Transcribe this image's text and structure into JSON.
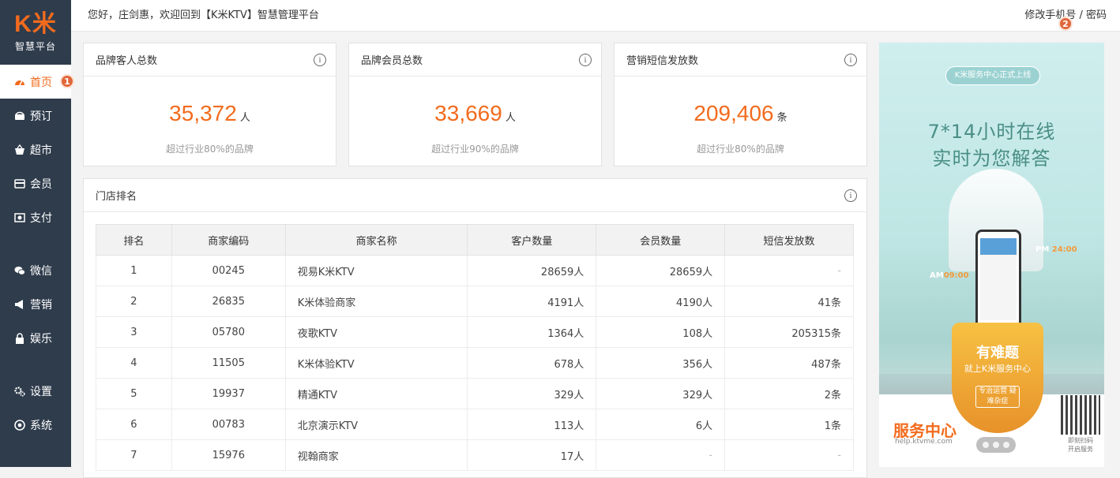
{
  "app": {
    "logo_text": "K米",
    "logo_subtitle": "智慧平台",
    "accent_color": "#f26b1d",
    "sidebar_color": "#2f3c4c"
  },
  "sidebar": {
    "items": [
      {
        "label": "首页",
        "icon": "dashboard-icon",
        "active": true,
        "badge": "1"
      },
      {
        "label": "预订",
        "icon": "booking-icon"
      },
      {
        "label": "超市",
        "icon": "basket-icon"
      },
      {
        "label": "会员",
        "icon": "card-icon"
      },
      {
        "label": "支付",
        "icon": "payment-icon"
      },
      {
        "label": "微信",
        "icon": "wechat-icon"
      },
      {
        "label": "营销",
        "icon": "megaphone-icon"
      },
      {
        "label": "娱乐",
        "icon": "lock-icon"
      },
      {
        "label": "设置",
        "icon": "gears-icon"
      },
      {
        "label": "系统",
        "icon": "chrome-icon"
      }
    ]
  },
  "topbar": {
    "greeting": "您好，庄剑惠，欢迎回到【K米KTV】智慧管理平台",
    "account_link": "修改手机号 / 密码",
    "account_badge": "2"
  },
  "stats": [
    {
      "title": "品牌客人总数",
      "value": "35,372",
      "unit": "人",
      "note": "超过行业80%的品牌"
    },
    {
      "title": "品牌会员总数",
      "value": "33,669",
      "unit": "人",
      "note": "超过行业90%的品牌"
    },
    {
      "title": "营销短信发放数",
      "value": "209,406",
      "unit": "条",
      "note": "超过行业80%的品牌"
    }
  ],
  "ranking": {
    "title": "门店排名",
    "headers": [
      "排名",
      "商家编码",
      "商家名称",
      "客户数量",
      "会员数量",
      "短信发放数"
    ],
    "rows": [
      [
        "1",
        "00245",
        "视易K米KTV",
        "28659人",
        "28659人",
        "-"
      ],
      [
        "2",
        "26835",
        "K米体验商家",
        "4191人",
        "4190人",
        "41条"
      ],
      [
        "3",
        "05780",
        "夜歌KTV",
        "1364人",
        "108人",
        "205315条"
      ],
      [
        "4",
        "11505",
        "K米体验KTV",
        "678人",
        "356人",
        "487条"
      ],
      [
        "5",
        "19937",
        "精通KTV",
        "329人",
        "329人",
        "2条"
      ],
      [
        "6",
        "00783",
        "北京演示KTV",
        "113人",
        "6人",
        "1条"
      ],
      [
        "7",
        "15976",
        "视翰商家",
        "17人",
        "-",
        "-"
      ]
    ]
  },
  "banner": {
    "tag": "K米服务中心正式上线",
    "headline_1": "7*14小时在线",
    "headline_2": "实时为您解答",
    "am_label": "AM",
    "am_time": "09:00",
    "pm_label": "PM",
    "pm_time": "24:00",
    "cup_title": "有难题",
    "cup_sub": "就上K米服务中心",
    "cup_tags": "专治运营 疑难杂症",
    "brand": "服务中心",
    "url": "help.ktvme.com",
    "qr_caption_1": "即刻扫码",
    "qr_caption_2": "开启服务"
  }
}
